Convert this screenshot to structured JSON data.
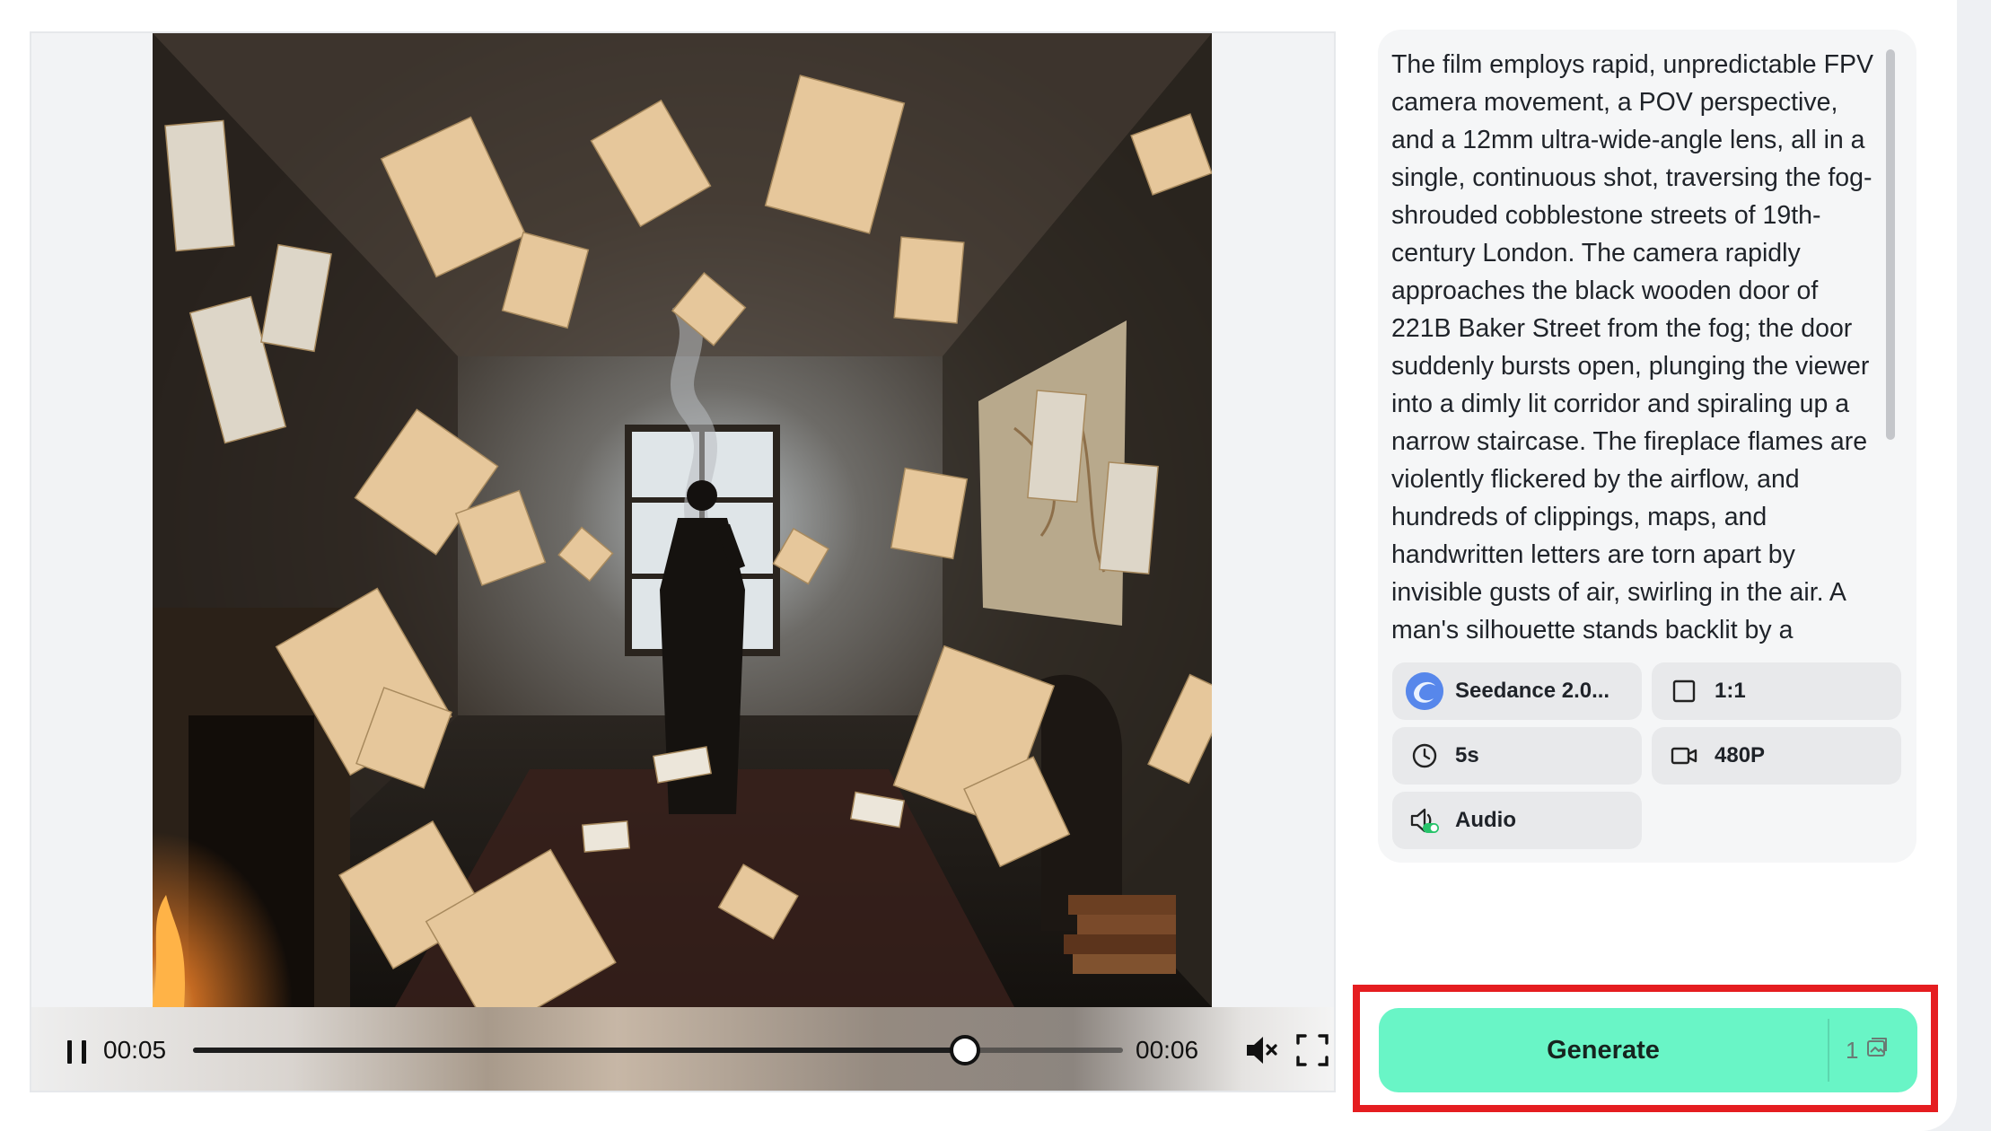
{
  "player": {
    "current_time": "00:05",
    "total_time": "00:06",
    "progress": 0.83,
    "muted": true
  },
  "prompt": {
    "text": "The film employs rapid, unpredictable FPV camera movement, a POV perspective, and a 12mm ultra-wide-angle lens, all in a single, continuous shot, traversing the fog-shrouded cobblestone streets of 19th-century London. The camera rapidly approaches the black wooden door of 221B Baker Street from the fog; the door suddenly bursts open, plunging the viewer into a dimly lit corridor and spiraling up a narrow staircase. The fireplace flames are violently flickered by the airflow, and hundreds of clippings, maps, and handwritten letters are torn apart by invisible gusts of air, swirling in the air. A man's silhouette stands backlit by a"
  },
  "options": {
    "model": "Seedance 2.0...",
    "ratio": "1:1",
    "duration": "5s",
    "resolution": "480P",
    "audio": "Audio"
  },
  "generate": {
    "label": "Generate",
    "credits": "1"
  },
  "colors": {
    "generate_bg": "#69f5c6",
    "highlight_border": "#e51d20",
    "panel_bg": "#f5f6f7",
    "option_bg": "#e8e9eb"
  },
  "icons": {
    "pause": "pause-icon",
    "mute": "speaker-muted-icon",
    "fullscreen": "fullscreen-icon",
    "model": "seedance-logo-icon",
    "ratio": "square-ratio-icon",
    "duration": "clock-icon",
    "resolution": "video-camera-icon",
    "audio": "audio-toggle-icon",
    "credit": "image-credit-icon"
  }
}
